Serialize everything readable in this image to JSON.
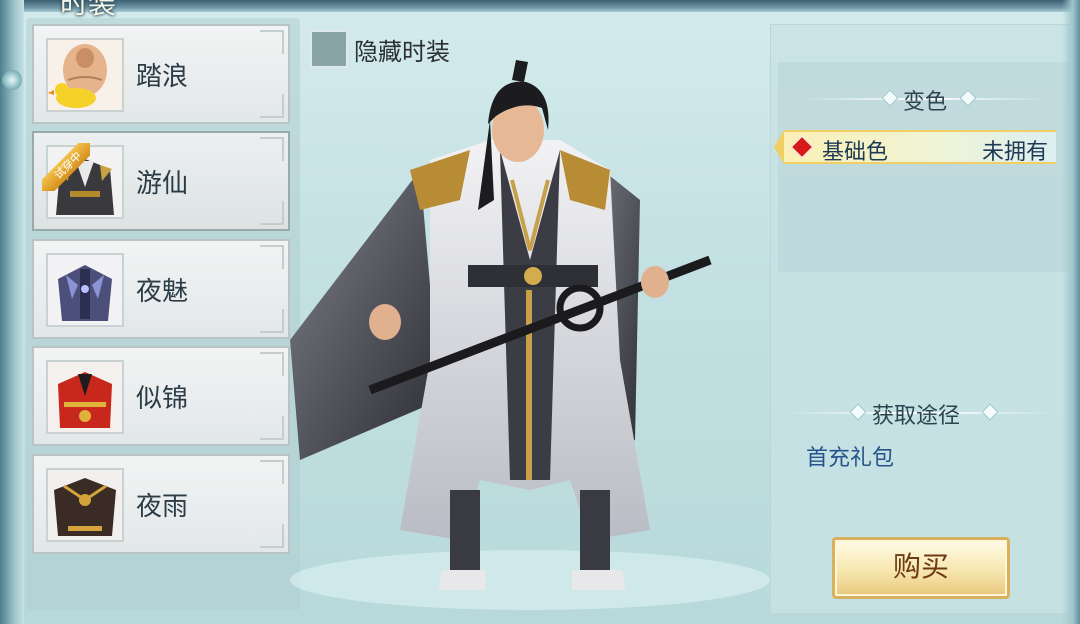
{
  "window": {
    "title": "时装"
  },
  "costume_list": {
    "items": [
      {
        "label": "踏浪",
        "icon": "swim-ring-costume-icon",
        "selected": false,
        "trial": false
      },
      {
        "label": "游仙",
        "icon": "immortal-robe-costume-icon",
        "selected": true,
        "trial": true,
        "badge": "试穿中"
      },
      {
        "label": "夜魅",
        "icon": "night-armor-costume-icon",
        "selected": false,
        "trial": false
      },
      {
        "label": "似锦",
        "icon": "red-robe-costume-icon",
        "selected": false,
        "trial": false
      },
      {
        "label": "夜雨",
        "icon": "dark-cloak-costume-icon",
        "selected": false,
        "trial": false
      }
    ]
  },
  "hide_costume": {
    "label": "隐藏时装",
    "checked": false
  },
  "color_section": {
    "title": "变色",
    "options": [
      {
        "name": "基础色",
        "status": "未拥有",
        "swatch_color": "#d61a1a"
      }
    ]
  },
  "acquire_section": {
    "title": "获取途径",
    "methods": [
      "首充礼包"
    ]
  },
  "buy_button": {
    "label": "购买"
  },
  "colors": {
    "accent_gold": "#d7b15d",
    "panel_bg": "#c3e0e2",
    "text_dark": "#2b3c46",
    "link_blue": "#24548a"
  }
}
